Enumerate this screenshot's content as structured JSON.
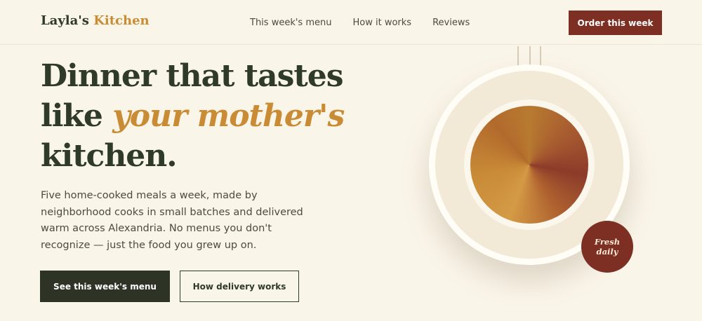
{
  "brand": {
    "name_part1": "Layla's",
    "name_part2": "Kitchen"
  },
  "nav": {
    "items": [
      {
        "label": "This week's menu"
      },
      {
        "label": "How it works"
      },
      {
        "label": "Reviews"
      }
    ],
    "cta_label": "Order this week"
  },
  "hero": {
    "headline_line1": "Dinner that tastes",
    "headline_line2_prefix": "like ",
    "headline_line2_emphasis": "your mother's",
    "headline_line3": "kitchen.",
    "lede": "Five home-cooked meals a week, made by neighborhood cooks in small batches and delivered warm across Alexandria. No menus you don't recognize — just the food you grew up on.",
    "primary_button": "See this week's menu",
    "secondary_button": "How delivery works"
  },
  "illustration": {
    "badge_text": "Fresh daily"
  },
  "colors": {
    "background": "#faf5e9",
    "text_dark": "#2f3a28",
    "accent_gold": "#c98c34",
    "accent_brick": "#7c2f22",
    "button_dark": "#2d3425"
  }
}
